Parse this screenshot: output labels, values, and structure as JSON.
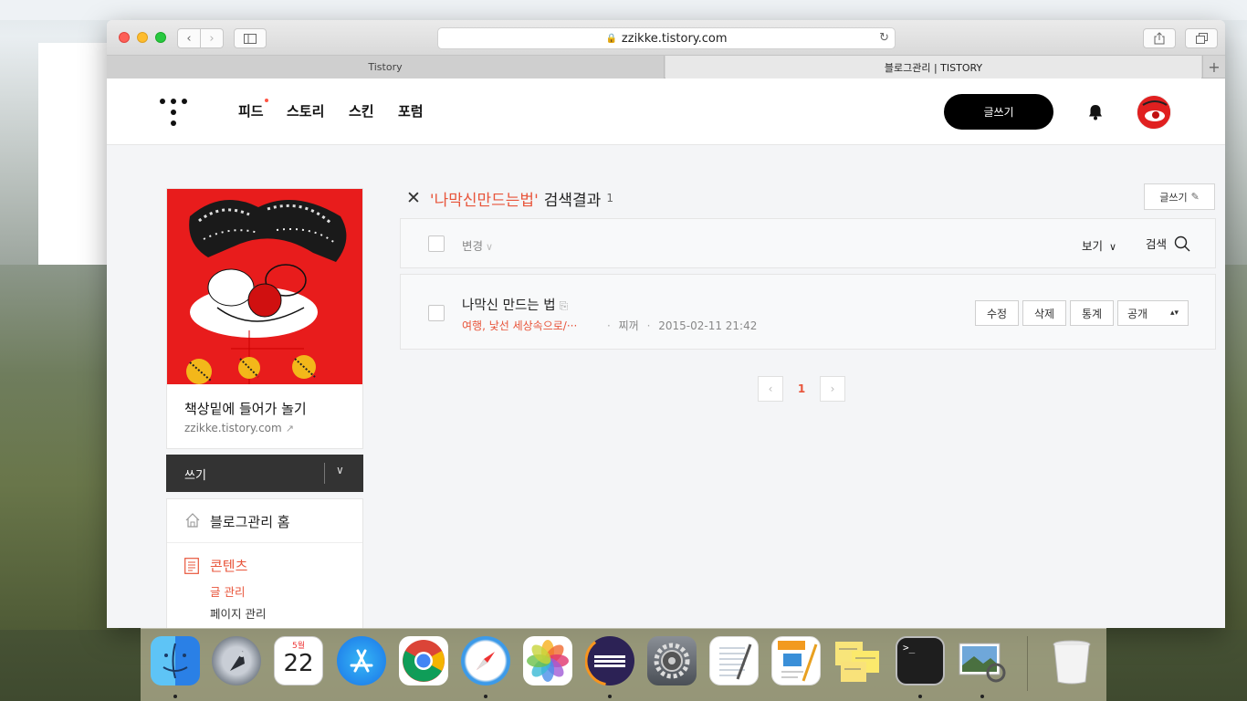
{
  "browser": {
    "url": "zzikke.tistory.com",
    "tabs": [
      {
        "label": "Tistory",
        "active": false
      },
      {
        "label": "블로그관리 | TISTORY",
        "active": true
      }
    ]
  },
  "topnav": {
    "items": [
      {
        "label": "피드",
        "has_dot": true
      },
      {
        "label": "스토리"
      },
      {
        "label": "스킨"
      },
      {
        "label": "포럼"
      }
    ],
    "write_label": "글쓰기"
  },
  "blog": {
    "name": "책상밑에 들어가 놀기",
    "url": "zzikke.tistory.com"
  },
  "write_bar": {
    "label": "쓰기"
  },
  "menu": {
    "home_label": "블로그관리 홈",
    "contents_label": "콘텐츠",
    "sub_posts": "글 관리",
    "sub_pages": "페이지 관리"
  },
  "search": {
    "keyword": "'나막신만드는법'",
    "suffix": "검색결과",
    "count": "1",
    "write_label": "글쓰기"
  },
  "toolbar": {
    "change_label": "변경",
    "view_label": "보기",
    "search_label": "검색"
  },
  "post": {
    "title": "나막신 만드는 법",
    "category": "여행, 낯선 세상속으로/···",
    "author": "찌꺼",
    "date": "2015-02-11 21:42",
    "buttons": {
      "edit": "수정",
      "delete": "삭제",
      "stats": "통계",
      "visibility": "공개"
    }
  },
  "pagination": {
    "current": "1"
  },
  "colors": {
    "accent": "#e8553b",
    "dark": "#000000"
  },
  "dock": {
    "apps": [
      "finder-icon",
      "launchpad-icon",
      "calendar-icon",
      "app-store-icon",
      "chrome-icon",
      "safari-icon",
      "photos-icon",
      "eclipse-icon",
      "system-preferences-icon",
      "textedit-icon",
      "pages-icon",
      "stickies-icon",
      "terminal-icon",
      "preview-icon",
      "trash-icon"
    ],
    "calendar": {
      "month": "5월",
      "day": "22"
    }
  }
}
